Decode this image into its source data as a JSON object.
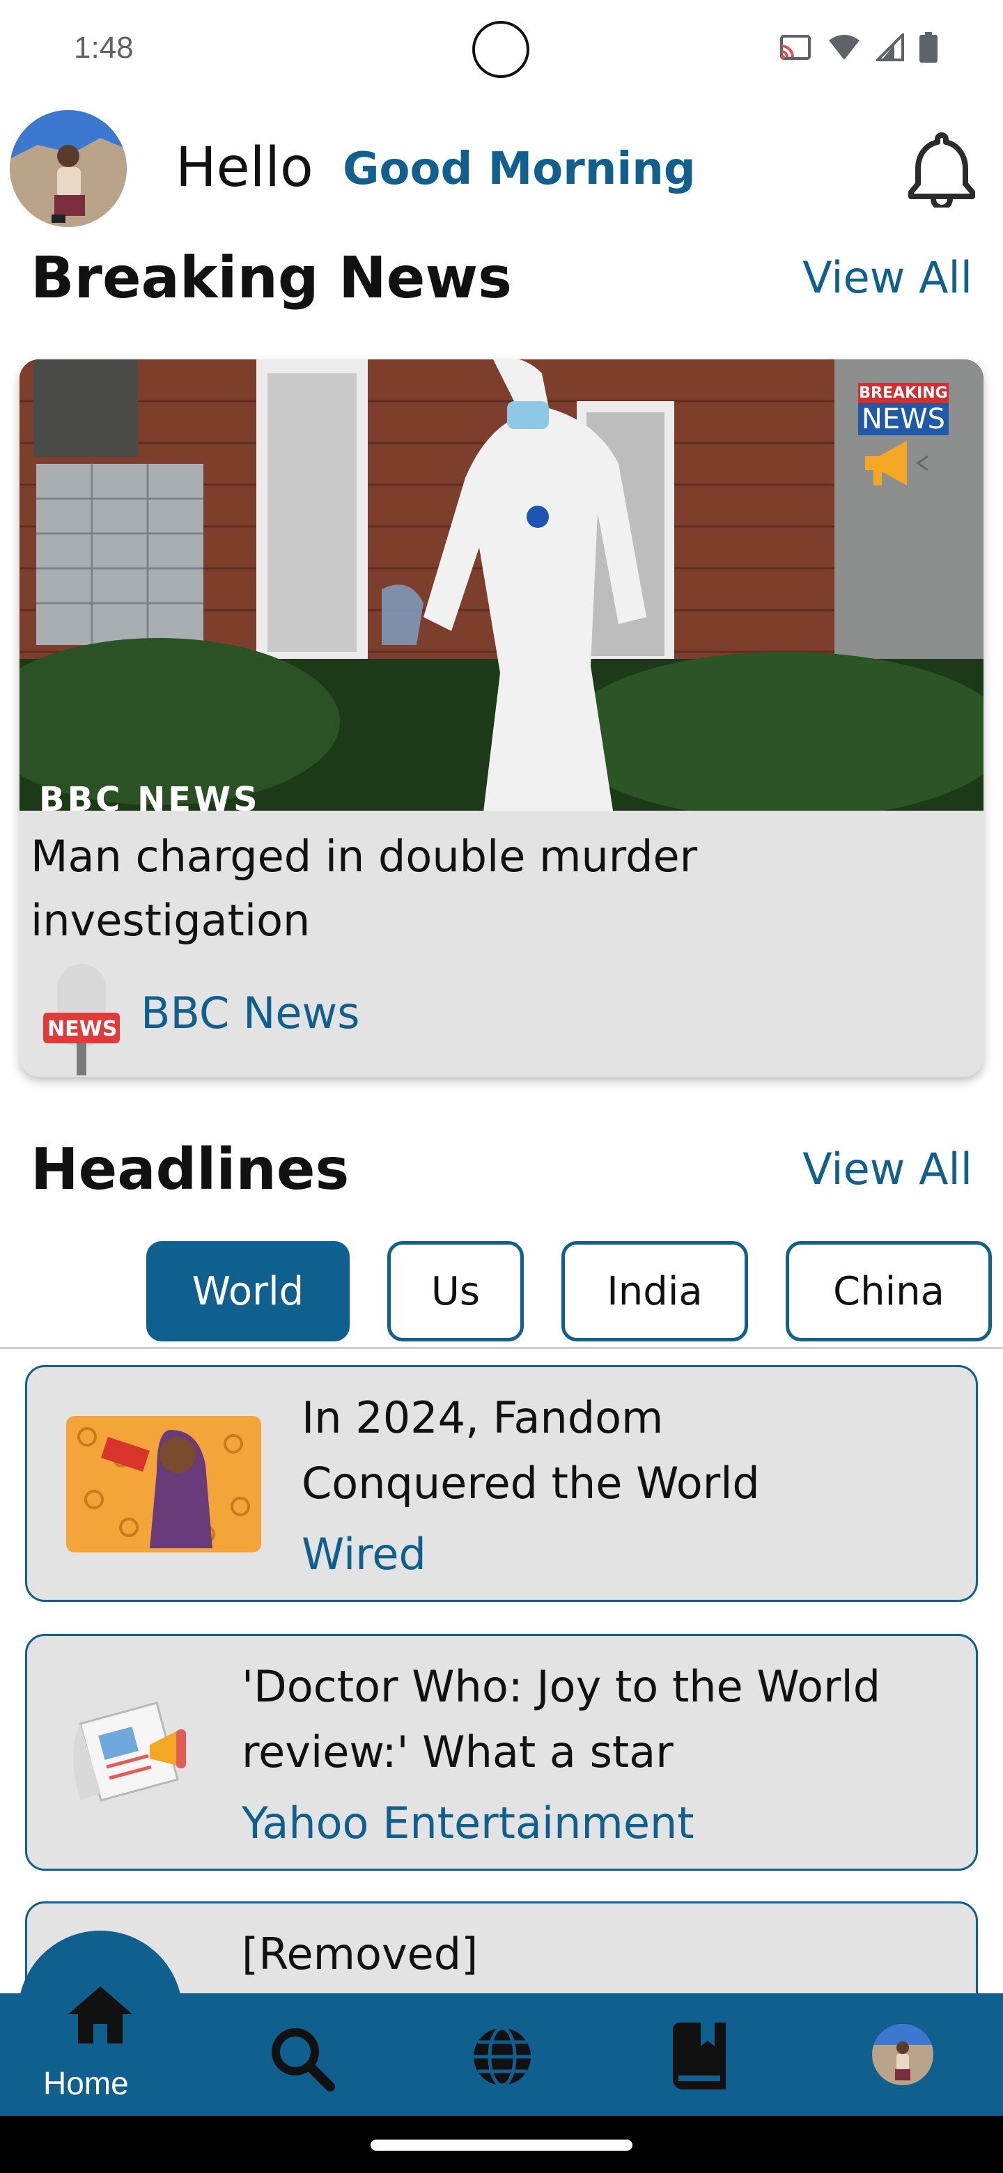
{
  "status": {
    "time": "1:48"
  },
  "header": {
    "hello": "Hello",
    "greeting": "Good Morning",
    "notification_icon": "bell-icon"
  },
  "breaking": {
    "title": "Breaking News",
    "view_all": "View All",
    "article": {
      "headline": "Man charged in double murder investigation",
      "source": "BBC News",
      "image_watermark": "BBC NEWS",
      "badge_top": "BREAKING",
      "badge_bottom": "NEWS",
      "mic_label": "NEWS"
    }
  },
  "headlines": {
    "title": "Headlines",
    "view_all": "View All",
    "tabs": [
      {
        "label": "World",
        "active": true
      },
      {
        "label": "Us",
        "active": false
      },
      {
        "label": "India",
        "active": false
      },
      {
        "label": "China",
        "active": false
      }
    ],
    "articles": [
      {
        "title_line1": "In 2024, Fandom",
        "title_line2": "Conquered the World",
        "source": "Wired"
      },
      {
        "title_line1": "'Doctor Who: Joy to the World",
        "title_line2": "review:' What a star",
        "source": "Yahoo Entertainment"
      },
      {
        "title_line1": "[Removed]",
        "title_line2": "",
        "source": ""
      }
    ]
  },
  "nav": {
    "items": [
      {
        "label": "Home",
        "icon": "home-icon"
      },
      {
        "label": "",
        "icon": "search-icon"
      },
      {
        "label": "",
        "icon": "globe-icon"
      },
      {
        "label": "",
        "icon": "bookmark-book-icon"
      },
      {
        "label": "",
        "icon": "profile-avatar"
      }
    ]
  },
  "colors": {
    "accent": "#0f5f8f",
    "card": "#e3e3e3"
  }
}
